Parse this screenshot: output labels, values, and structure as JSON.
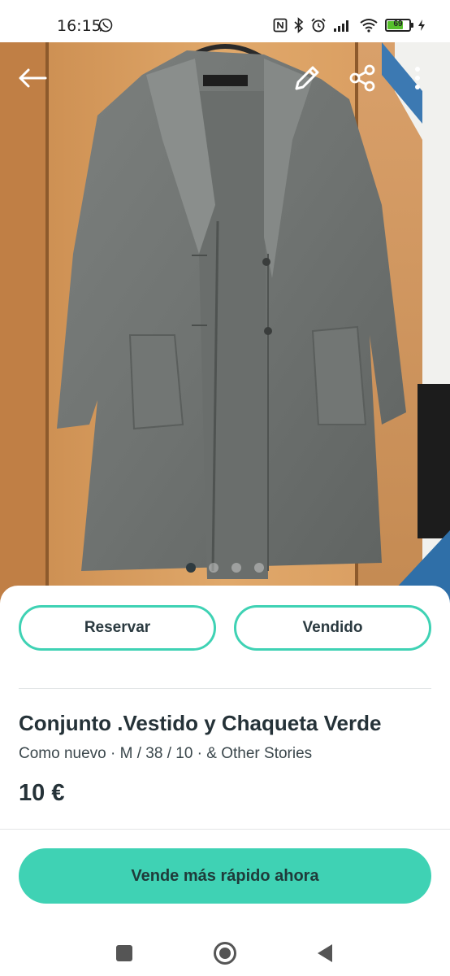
{
  "status_bar": {
    "time": "16:15",
    "battery_level": "69",
    "battery_fraction": 0.69,
    "icons": [
      "whatsapp-icon",
      "nfc-icon",
      "bluetooth-icon",
      "alarm-icon",
      "signal-icon",
      "wifi-icon",
      "battery-icon",
      "charging-icon"
    ]
  },
  "photo": {
    "image_count": 4,
    "active_index": 0,
    "top_icons": [
      "back-arrow-icon",
      "edit-pencil-icon",
      "share-icon",
      "more-vertical-icon"
    ]
  },
  "actions": {
    "reserve_label": "Reservar",
    "sold_label": "Vendido"
  },
  "product": {
    "title": "Conjunto .Vestido y Chaqueta Verde",
    "subtitle": "Como nuevo · M / 38 / 10 · & Other Stories",
    "price": "10 €"
  },
  "cta": {
    "label": "Vende más rápido ahora"
  },
  "nav_bar": {
    "icons": [
      "recents-square-icon",
      "home-circle-icon",
      "back-triangle-icon"
    ]
  },
  "colors": {
    "accent": "#3fd2b4",
    "text_dark": "#253238",
    "battery_green": "#56c02b"
  }
}
